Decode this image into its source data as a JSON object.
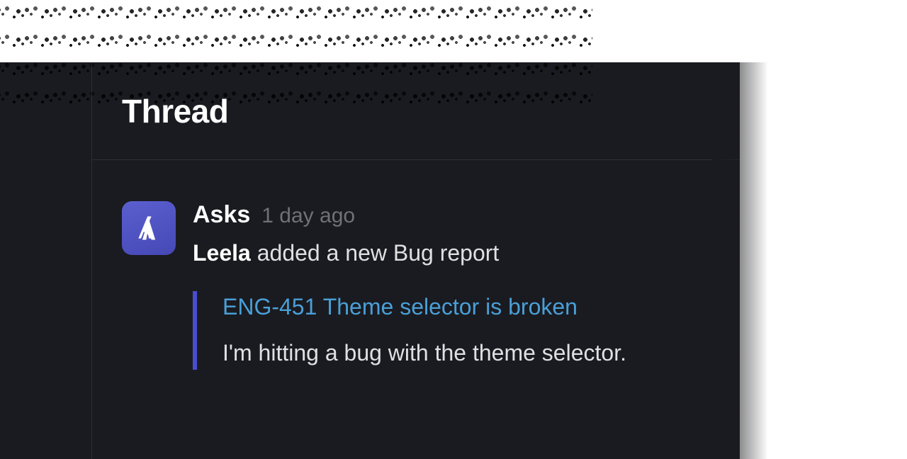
{
  "header": {
    "title": "Thread"
  },
  "message": {
    "sender": "Asks",
    "timestamp": "1 day ago",
    "actor": "Leela",
    "action_text": " added a new Bug report",
    "avatar_icon": "asks-app-icon",
    "avatar_bg": "#4e52c7"
  },
  "attachment": {
    "title": "ENG-451 Theme selector is broken",
    "description": "I'm hitting a bug with the theme selector.",
    "accent_color": "#4a4dd0",
    "link_color": "#4a9fd8"
  }
}
